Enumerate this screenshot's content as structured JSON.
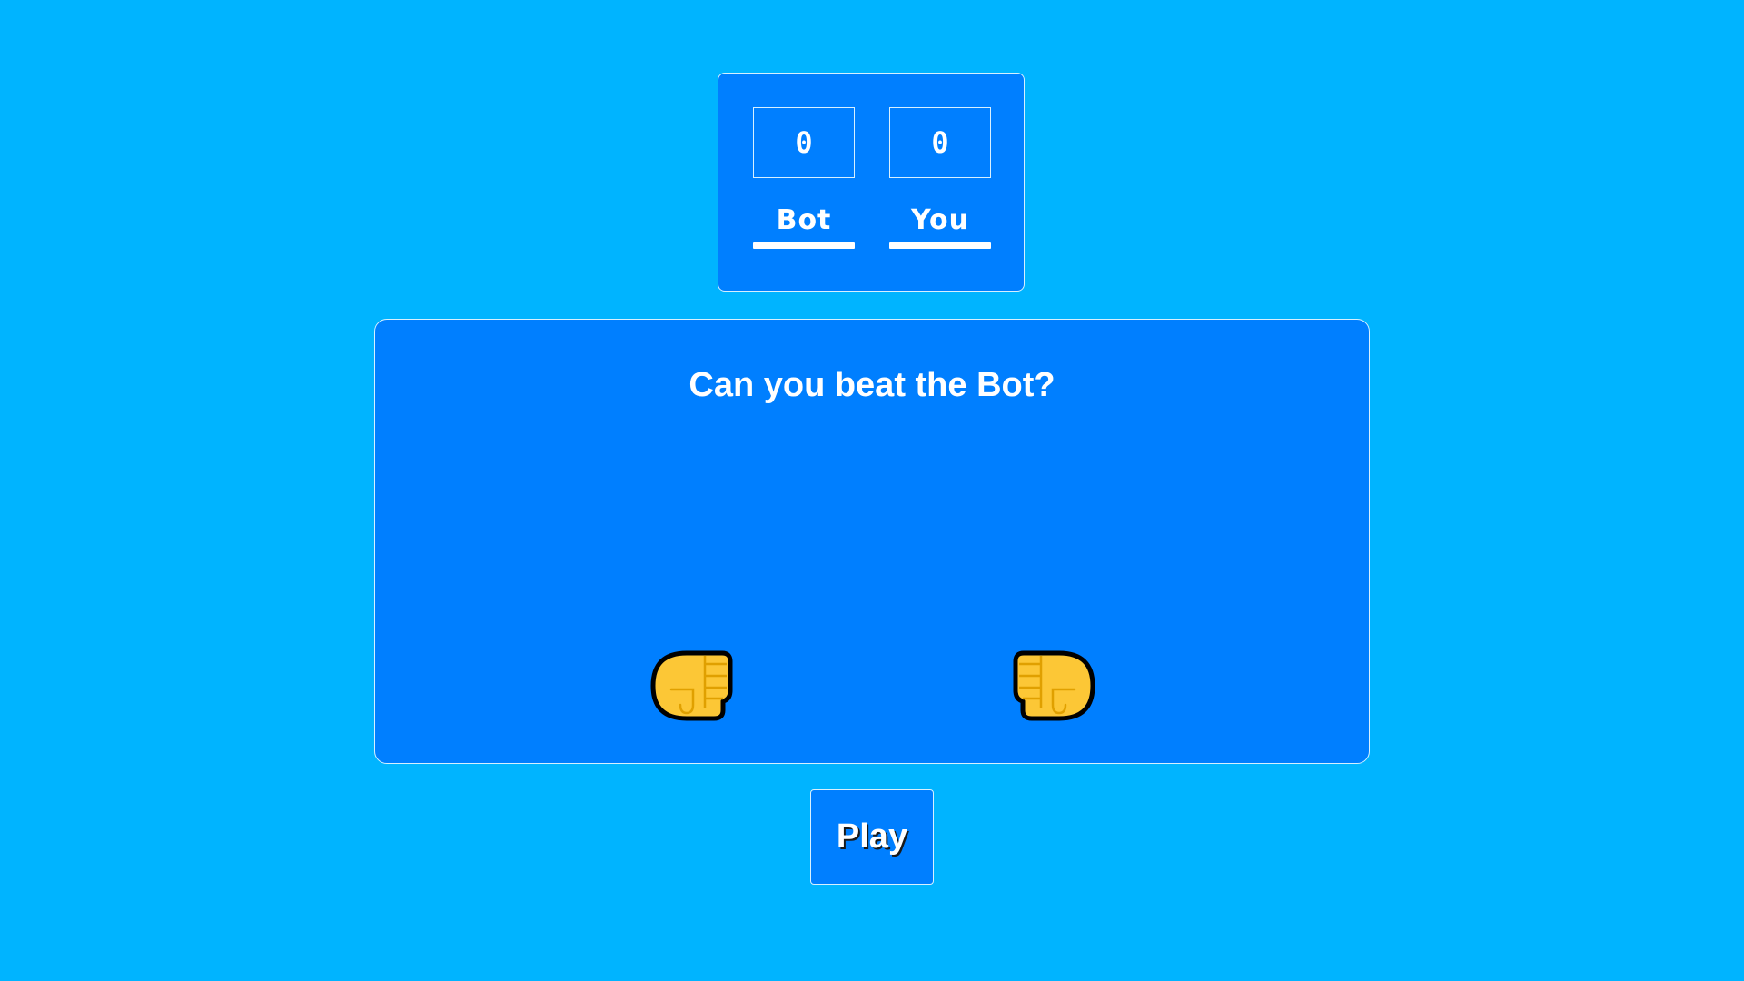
{
  "scoreboard": {
    "bot": {
      "score": "0",
      "label": "Bot"
    },
    "you": {
      "score": "0",
      "label": "You"
    }
  },
  "arena": {
    "title": "Can you beat the Bot?",
    "bot_hand": "fist-icon",
    "you_hand": "fist-icon"
  },
  "controls": {
    "play_label": "Play"
  },
  "colors": {
    "background": "#00b4ff",
    "panel": "#007fff",
    "border": "#d7f0ff",
    "text": "#ffffff",
    "fist_fill": "#fcc736",
    "fist_line": "#e0a000"
  }
}
